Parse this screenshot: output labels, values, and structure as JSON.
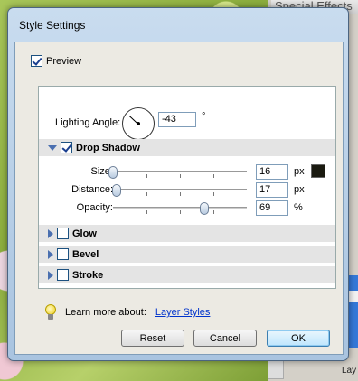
{
  "background_panel": {
    "title": "Special Effects",
    "layer_label": "Lay"
  },
  "dialog": {
    "title": "Style Settings",
    "preview": {
      "label": "Preview",
      "checked": true
    },
    "lighting": {
      "label": "Lighting Angle:",
      "value": "-43",
      "unit": "°"
    },
    "drop_shadow": {
      "label": "Drop Shadow",
      "checked": true,
      "expanded": true,
      "color": "#1a1a10",
      "controls": [
        {
          "label": "Size:",
          "value": "16",
          "unit": "px",
          "fraction": 0.0
        },
        {
          "label": "Distance:",
          "value": "17",
          "unit": "px",
          "fraction": 0.03
        },
        {
          "label": "Opacity:",
          "value": "69",
          "unit": "%",
          "fraction": 0.68
        }
      ]
    },
    "effects": [
      {
        "label": "Glow",
        "checked": false
      },
      {
        "label": "Bevel",
        "checked": false
      },
      {
        "label": "Stroke",
        "checked": false
      }
    ],
    "help": {
      "text": "Learn more about:",
      "link": "Layer Styles"
    },
    "buttons": {
      "reset": "Reset",
      "cancel": "Cancel",
      "ok": "OK"
    }
  },
  "colors": {
    "accent": "#3c7fb1",
    "link": "#0033cc",
    "triangle": "#4a6fb0"
  }
}
